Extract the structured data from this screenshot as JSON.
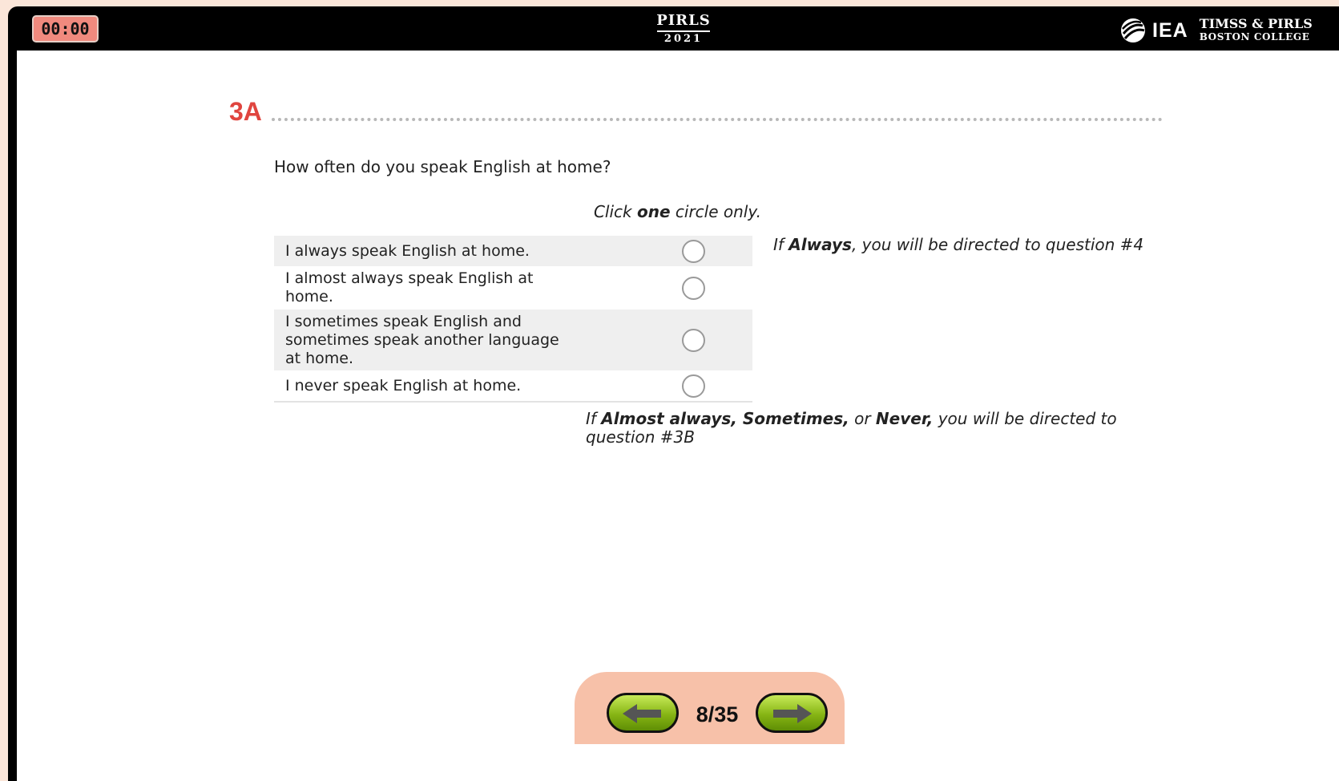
{
  "header": {
    "timer": "00:00",
    "logo_pirls": "PIRLS",
    "logo_year": "2021",
    "logo_iea": "IEA",
    "logo_timss_pirls": "TIMSS & PIRLS",
    "logo_boston_college": "BOSTON COLLEGE"
  },
  "question": {
    "number": "3A",
    "text": "How often do you speak English at home?",
    "instruction_prefix": "Click ",
    "instruction_bold": "one",
    "instruction_suffix": " circle only.",
    "options": [
      {
        "label": "I always speak English at home.",
        "selected": false
      },
      {
        "label": "I almost always speak English at home.",
        "selected": false
      },
      {
        "label": "I sometimes speak English and sometimes speak another language at home.",
        "selected": false
      },
      {
        "label": "I never speak English at home.",
        "selected": false
      }
    ],
    "note_always": {
      "prefix": "If ",
      "bold": "Always",
      "suffix": ", you will be directed to question #4"
    },
    "note_other": {
      "prefix": "If ",
      "bold1": "Almost always, Sometimes,",
      "middle": " or ",
      "bold2": "Never,",
      "suffix": " you will be directed to question #3B"
    }
  },
  "navigation": {
    "page_counter": "8/35",
    "prev_icon": "left-arrow-icon",
    "next_icon": "right-arrow-icon"
  },
  "colors": {
    "question_number": "#e0453f",
    "timer_bg": "#f08a7e",
    "nav_panel": "#f7c1a9",
    "nav_button": "#86b514"
  }
}
